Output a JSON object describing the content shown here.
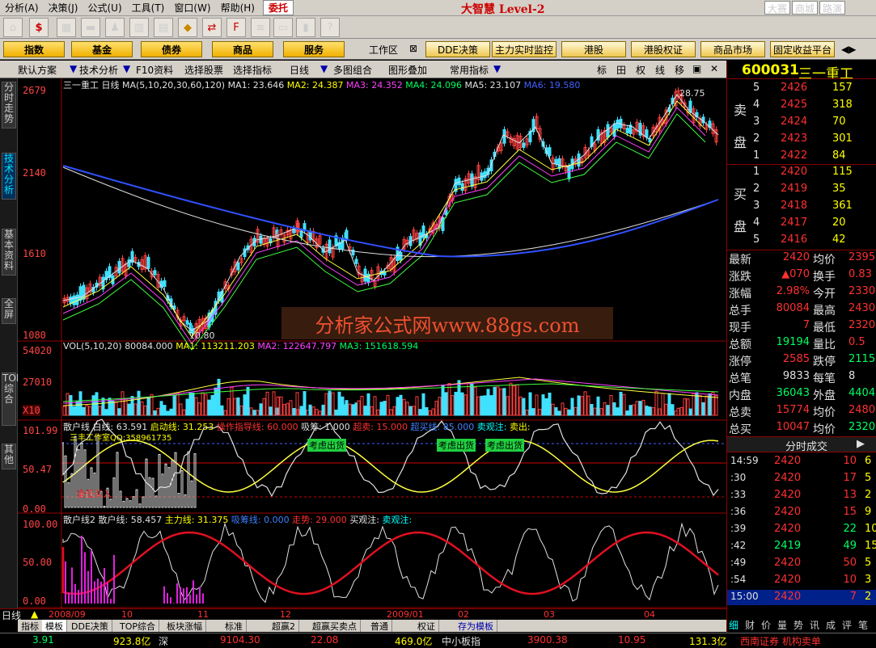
{
  "menu": {
    "items": [
      "分析(A)",
      "决策(J)",
      "公式(U)",
      "工具(T)",
      "窗口(W)",
      "帮助(H)"
    ],
    "trust": "委托",
    "brand": "大智慧 Level-2",
    "right": [
      "大赛",
      "商城",
      "路演"
    ]
  },
  "nav": {
    "buttons": [
      "指数",
      "基金",
      "债券",
      "商品",
      "服务"
    ],
    "workspace": "工作区",
    "right": [
      "DDE决策",
      "主力实时监控",
      "港股",
      "港股权证",
      "商品市场",
      "固定收益平台"
    ]
  },
  "toolbar2": {
    "items": [
      "默认方案",
      "技术分析",
      "F10资料",
      "选择股票",
      "选择指标",
      "日线",
      "多图组合",
      "图形叠加",
      "常用指标"
    ],
    "right": [
      "标",
      "田",
      "权",
      "线",
      "移"
    ]
  },
  "side_tabs": [
    "分时走势",
    "技术分析",
    "基本资料",
    "全屏",
    "TOP综合",
    "其他"
  ],
  "chart": {
    "stock_title": "三一重工",
    "period": "日线",
    "ma_legend": {
      "label": "MA(5,10,20,30,60,120)",
      "ma1": "MA1: 23.646",
      "ma2": "MA2: 24.387",
      "ma3": "MA3: 24.352",
      "ma4": "MA4: 24.096",
      "ma5": "MA5: 23.107",
      "ma6": "MA6: 19.580"
    },
    "price_ticks": [
      "2679",
      "2140",
      "1610",
      "1080"
    ],
    "high_label": "28.75",
    "low_label": "10.80",
    "vol_legend": {
      "label": "VOL(5,10,20)",
      "vol": "80084.000",
      "ma1": "MA1: 113211.203",
      "ma2": "MA2: 122647.797",
      "ma3": "MA3: 151618.594"
    },
    "vol_ticks": [
      "54020",
      "27010",
      "X10"
    ],
    "ind1_legend": {
      "label": "散户线",
      "a": "白线: 63.591",
      "b": "启动线: 31.253",
      "c": "操作指导线: 60.000",
      "d": "吸筹: 1.000",
      "e": "超卖: 15.000",
      "f": "超买线: 85.000",
      "g": "卖观注:",
      "h": "卖出:"
    },
    "ind1_ticks": [
      "101.99",
      "50.47",
      "0.00"
    ],
    "ind1_annotations": [
      "考虑出货",
      "考虑出货",
      "考虑出货",
      "逢低买入",
      "三丰工作室QQ:358961735"
    ],
    "ind2_legend": {
      "label": "散户线2",
      "a": "散户线: 58.457",
      "b": "主力线: 31.375",
      "c": "吸筹线: 0.000",
      "d": "走势: 29.000",
      "e": "买观注:",
      "f": "卖观注:"
    },
    "ind2_ticks": [
      "100.00",
      "50.00",
      "0.00"
    ],
    "watermark": "分析家公式网www.88gs.com",
    "dates": [
      "2008/09",
      "10",
      "11",
      "12",
      "2009/01",
      "02",
      "03",
      "04"
    ],
    "period_label": "日线"
  },
  "bottom_tabs": [
    "指标",
    "模板",
    "DDE决策",
    "TOP综合",
    "板块涨幅",
    "标准",
    "超赢2",
    "超赢买卖点",
    "普通",
    "权证",
    "存为模板"
  ],
  "status": {
    "items": [
      "3.91",
      "923.8亿",
      "深",
      "9104.30",
      "22.08",
      "469.0亿",
      "中小板指",
      "3900.38",
      "10.95",
      "131.3亿",
      "西南证券 机构卖单"
    ]
  },
  "quote": {
    "code": "600031",
    "name": "三一重工",
    "sell": [
      [
        "5",
        "2426",
        "157"
      ],
      [
        "4",
        "2425",
        "318"
      ],
      [
        "3",
        "2424",
        "70"
      ],
      [
        "2",
        "2423",
        "301"
      ],
      [
        "1",
        "2422",
        "84"
      ]
    ],
    "buy": [
      [
        "1",
        "2420",
        "115"
      ],
      [
        "2",
        "2419",
        "35"
      ],
      [
        "3",
        "2418",
        "361"
      ],
      [
        "4",
        "2417",
        "20"
      ],
      [
        "5",
        "2416",
        "42"
      ]
    ],
    "sell_label": [
      "卖",
      "盘"
    ],
    "buy_label": [
      "买",
      "盘"
    ],
    "stats": [
      [
        "最新",
        "2420",
        "均价",
        "2395"
      ],
      [
        "涨跌",
        "▲070",
        "换手",
        "0.83"
      ],
      [
        "涨幅",
        "2.98%",
        "今开",
        "2330"
      ],
      [
        "总手",
        "80084",
        "最高",
        "2430"
      ],
      [
        "现手",
        "7",
        "最低",
        "2320"
      ],
      [
        "总额",
        "19194",
        "量比",
        "0.5"
      ],
      [
        "涨停",
        "2585",
        "跌停",
        "2115"
      ],
      [
        "总笔",
        "9833",
        "每笔",
        "8"
      ],
      [
        "内盘",
        "36043",
        "外盘",
        "44041"
      ],
      [
        "总卖",
        "15774",
        "均价",
        "2480"
      ],
      [
        "总买",
        "10047",
        "均价",
        "2320"
      ]
    ],
    "ticks_title": "分时成交",
    "ticks": [
      [
        "14:59",
        "2420",
        "10",
        "6"
      ],
      [
        ":30",
        "2420",
        "17",
        "5"
      ],
      [
        ":33",
        "2420",
        "13",
        "2"
      ],
      [
        ":36",
        "2420",
        "15",
        "9"
      ],
      [
        ":39",
        "2420",
        "22",
        "10"
      ],
      [
        ":42",
        "2419",
        "49",
        "15"
      ],
      [
        ":49",
        "2420",
        "50",
        "5"
      ],
      [
        ":54",
        "2420",
        "10",
        "3"
      ],
      [
        "15:00",
        "2420",
        "7",
        "2"
      ]
    ],
    "bottom_tabs": [
      "细",
      "财",
      "价",
      "量",
      "势",
      "讯",
      "成",
      "评",
      "笔"
    ]
  }
}
